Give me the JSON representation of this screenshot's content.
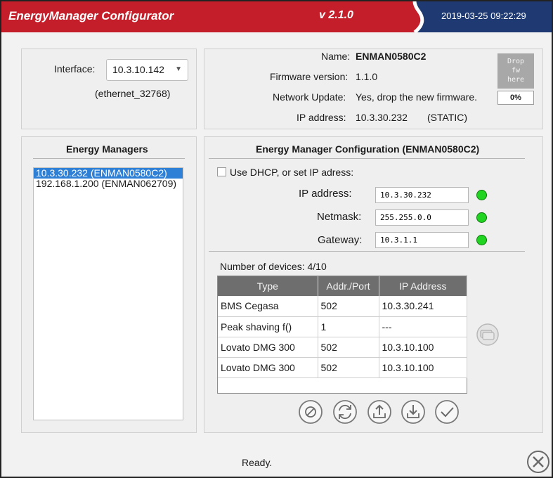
{
  "titlebar": {
    "app_title": "EnergyManager Configurator",
    "version": "v 2.1.0",
    "datetime": "2019-03-25 09:22:29"
  },
  "interface": {
    "label": "Interface:",
    "selected": "10.3.10.142",
    "adapter": "(ethernet_32768)"
  },
  "device_info": {
    "name_label": "Name:",
    "name_value": "ENMAN0580C2",
    "firmware_label": "Firmware version:",
    "firmware_value": "1.1.0",
    "network_update_label": "Network Update:",
    "network_update_value": "Yes, drop the new firmware.",
    "ip_label": "IP address:",
    "ip_value": "10.3.30.232",
    "ip_mode": "(STATIC)",
    "drop_fw_line1": "Drop",
    "drop_fw_line2": "fw",
    "drop_fw_line3": "here",
    "fw_progress": "0%"
  },
  "energy_managers": {
    "title": "Energy Managers",
    "items": [
      {
        "label": "10.3.30.232 (ENMAN0580C2)",
        "selected": true
      },
      {
        "label": "192.168.1.200 (ENMAN062709)",
        "selected": false
      }
    ]
  },
  "config": {
    "title": "Energy Manager Configuration (ENMAN0580C2)",
    "dhcp_label": "Use DHCP, or set IP adress:",
    "dhcp_checked": false,
    "ip_label": "IP address:",
    "ip_value": "10.3.30.232",
    "netmask_label": "Netmask:",
    "netmask_value": "255.255.0.0",
    "gateway_label": "Gateway:",
    "gateway_value": "10.3.1.1",
    "status_color": "#21d421",
    "devices_count": "Number of devices: 4/10",
    "table": {
      "headers": [
        "Type",
        "Addr./Port",
        "IP Address"
      ],
      "rows": [
        [
          "BMS Cegasa",
          "502",
          "10.3.30.241"
        ],
        [
          "Peak shaving f()",
          "1",
          "---"
        ],
        [
          "Lovato DMG 300",
          "502",
          "10.3.10.100"
        ],
        [
          "Lovato DMG 300",
          "502",
          "10.3.10.100"
        ]
      ]
    },
    "action_icons": [
      "cancel-icon",
      "refresh-icon",
      "upload-icon",
      "download-icon",
      "confirm-icon"
    ]
  },
  "status": {
    "text": "Ready."
  },
  "colors": {
    "titlebar": "#c41e2a",
    "titlebar_accent": "#1f3a73",
    "selection": "#2e7fd6",
    "table_header": "#6e6e6e"
  }
}
